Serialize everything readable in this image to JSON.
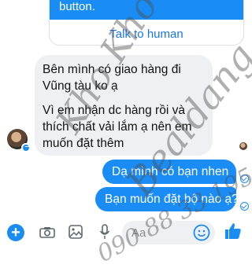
{
  "bot_card": {
    "strip_text": "button.",
    "talk_to_human": "Talk to human"
  },
  "incoming": {
    "lines": [
      "Bên mình có giao hàng đi",
      "Vũng tàu ko ạ",
      "Vì em nhận dc hàng rồi và",
      "thích chất vải lắm ạ nên em",
      "muốn đặt thêm"
    ]
  },
  "outgoing": [
    "Dạ mình có bạn nhen",
    "Bạn muốn đặt bộ nào ạ?"
  ],
  "composer": {
    "placeholder": "Aa",
    "icons": [
      "plus-icon",
      "camera-icon",
      "photo-icon",
      "microphone-icon",
      "emoji-icon",
      "like-icon"
    ]
  },
  "watermark": {
    "line1": "Kho Kho",
    "line2": "Bealdang",
    "line3": "090 88 33 195"
  },
  "colors": {
    "accent": "#1a8cf5",
    "bubble_gray": "#eef0f3"
  }
}
